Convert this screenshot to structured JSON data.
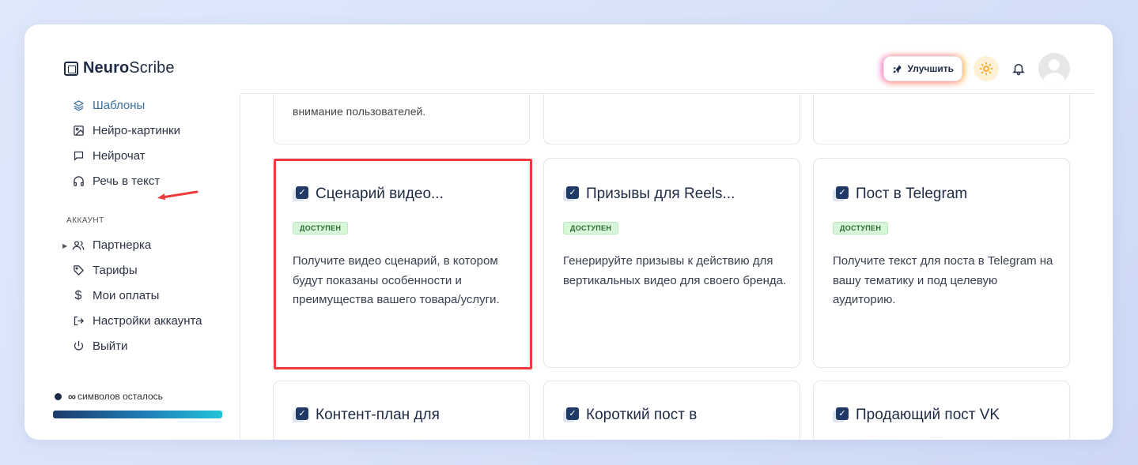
{
  "brand": {
    "bold": "Neuro",
    "light": "Scribe"
  },
  "header": {
    "upgrade_label": "Улучшить",
    "upgrade_icon": "rocket-icon",
    "theme_icon": "sun-icon",
    "notifications_icon": "bell-icon",
    "avatar_icon": "user-avatar"
  },
  "sidebar": {
    "items": [
      {
        "label": "Шаблоны",
        "icon": "layers-icon",
        "active": true
      },
      {
        "label": "Нейро-картинки",
        "icon": "image-icon"
      },
      {
        "label": "Нейрочат",
        "icon": "chat-icon"
      },
      {
        "label": "Речь в текст",
        "icon": "headphones-icon"
      }
    ],
    "account_label": "АККАУНТ",
    "account_items": [
      {
        "label": "Партнерка",
        "icon": "users-icon",
        "expandable": true
      },
      {
        "label": "Тарифы",
        "icon": "tag-icon"
      },
      {
        "label": "Мои оплаты",
        "icon": "dollar-icon"
      },
      {
        "label": "Настройки аккаунта",
        "icon": "login-icon"
      },
      {
        "label": "Выйти",
        "icon": "power-icon"
      }
    ],
    "credits": {
      "symbol": "∞",
      "text": "символов осталось",
      "fill_percent": 100
    }
  },
  "cards_top": [
    {
      "text": "внимание пользователей."
    },
    {
      "text": ""
    },
    {
      "text": ""
    }
  ],
  "cards": [
    {
      "title": "Сценарий видео...",
      "badge": "ДОСТУПЕН",
      "description": "Получите видео сценарий, в котором будут показаны особенности и преимущества вашего товара/услуги.",
      "highlighted": true
    },
    {
      "title": "Призывы для Reels...",
      "badge": "ДОСТУПЕН",
      "description": "Генерируйте призывы к действию для вертикальных видео для своего бренда."
    },
    {
      "title": "Пост в Telegram",
      "badge": "ДОСТУПЕН",
      "description": "Получите текст для поста в Telegram на вашу тематику и под целевую аудиторию."
    }
  ],
  "cards_bottom": [
    {
      "title": "Контент-план для"
    },
    {
      "title": "Короткий пост в"
    },
    {
      "title": "Продающий пост VK"
    }
  ],
  "colors": {
    "highlight": "#ee3b3b",
    "active_nav": "#3a6fa0",
    "badge_bg": "#d8f6d9",
    "brand_dark": "#1f2a44"
  }
}
